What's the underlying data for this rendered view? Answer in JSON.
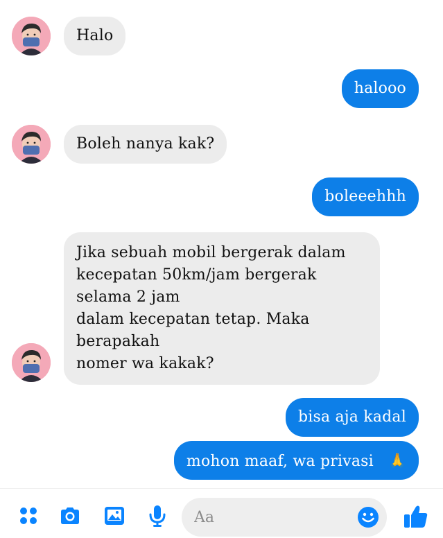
{
  "messages": [
    {
      "side": "in",
      "text": "Halo"
    },
    {
      "side": "out",
      "text": "halooo"
    },
    {
      "side": "in",
      "text": "Boleh nanya kak?"
    },
    {
      "side": "out",
      "text": "boleeehhh"
    },
    {
      "side": "in",
      "text": "Jika sebuah mobil bergerak dalam\nkecepatan 50km/jam bergerak\nselama 2 jam\ndalam kecepatan tetap. Maka\nberapakah\nnomer wa kakak?"
    },
    {
      "side": "out",
      "text": "bisa aja kadal"
    },
    {
      "side": "out",
      "text": "mohon maaf, wa privasi",
      "emoji": "🙏"
    }
  ],
  "composer": {
    "placeholder": "Aa",
    "icons": [
      "menu-dots-icon",
      "camera-icon",
      "image-icon",
      "microphone-icon",
      "emoji-icon",
      "thumbs-up-icon"
    ]
  },
  "colors": {
    "outgoing_bubble": "#0d7fe8",
    "incoming_bubble": "#ececec",
    "accent": "#0a84ff",
    "avatar_bg": "#f4a9b8"
  }
}
